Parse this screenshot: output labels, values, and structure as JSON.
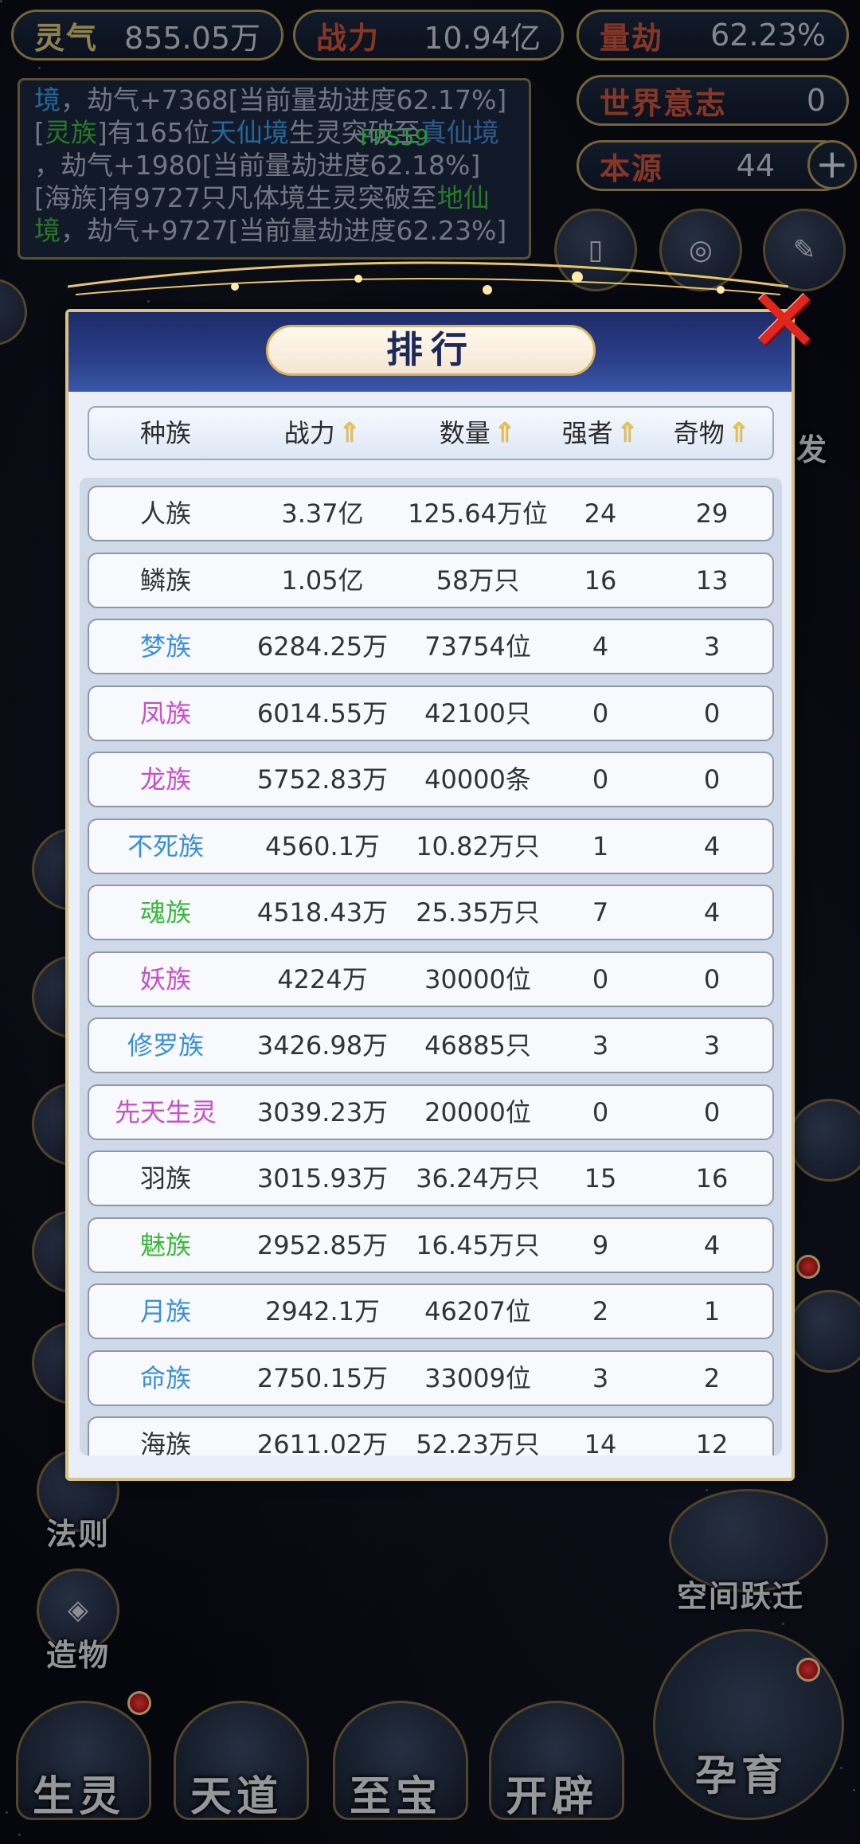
{
  "resources": {
    "lingqi": {
      "label": "灵气",
      "value": "855.05万"
    },
    "zhanli": {
      "label": "战力",
      "value": "10.94亿"
    },
    "liangjie": {
      "label": "量劫",
      "value": "62.23%"
    },
    "world_will": {
      "label": "世界意志",
      "value": "0"
    },
    "benyuan": {
      "label": "本源",
      "value": "44"
    }
  },
  "fps": "FPS59",
  "log": [
    [
      "境",
      "，劫气+7368[当前量劫进度62.17%]"
    ],
    [
      "[",
      "灵族",
      "]有165位",
      "天仙境",
      "生灵突破至",
      "真仙境"
    ],
    [
      "，劫气+1980[当前量劫进度62.18%]"
    ],
    [
      "[海族]有9727只凡体境生灵突破至",
      "地仙"
    ],
    [
      "境",
      "，劫气+9727[当前量劫进度62.23%]"
    ]
  ],
  "side_labels": {
    "fa_ze": "法则",
    "zao_wu": "造物",
    "kong_jian": "空间跃迁",
    "fa": "发"
  },
  "nav": [
    "生灵",
    "天道",
    "至宝",
    "开辟",
    "孕育"
  ],
  "modal": {
    "title": "排行",
    "columns": [
      "种族",
      "战力",
      "数量",
      "强者",
      "奇物"
    ],
    "rows": [
      {
        "race": "人族",
        "power": "3.37亿",
        "count": "125.64万位",
        "strong": "24",
        "items": "29",
        "color": "#333333"
      },
      {
        "race": "鳞族",
        "power": "1.05亿",
        "count": "58万只",
        "strong": "16",
        "items": "13",
        "color": "#333333"
      },
      {
        "race": "梦族",
        "power": "6284.25万",
        "count": "73754位",
        "strong": "4",
        "items": "3",
        "color": "#3a8fd9"
      },
      {
        "race": "凤族",
        "power": "6014.55万",
        "count": "42100只",
        "strong": "0",
        "items": "0",
        "color": "#c84fc8"
      },
      {
        "race": "龙族",
        "power": "5752.83万",
        "count": "40000条",
        "strong": "0",
        "items": "0",
        "color": "#c84fc8"
      },
      {
        "race": "不死族",
        "power": "4560.1万",
        "count": "10.82万只",
        "strong": "1",
        "items": "4",
        "color": "#3a8fd9"
      },
      {
        "race": "魂族",
        "power": "4518.43万",
        "count": "25.35万只",
        "strong": "7",
        "items": "4",
        "color": "#39b739"
      },
      {
        "race": "妖族",
        "power": "4224万",
        "count": "30000位",
        "strong": "0",
        "items": "0",
        "color": "#c84fc8"
      },
      {
        "race": "修罗族",
        "power": "3426.98万",
        "count": "46885只",
        "strong": "3",
        "items": "3",
        "color": "#3a8fd9"
      },
      {
        "race": "先天生灵",
        "power": "3039.23万",
        "count": "20000位",
        "strong": "0",
        "items": "0",
        "color": "#c84fc8"
      },
      {
        "race": "羽族",
        "power": "3015.93万",
        "count": "36.24万只",
        "strong": "15",
        "items": "16",
        "color": "#333333"
      },
      {
        "race": "魅族",
        "power": "2952.85万",
        "count": "16.45万只",
        "strong": "9",
        "items": "4",
        "color": "#39b739"
      },
      {
        "race": "月族",
        "power": "2942.1万",
        "count": "46207位",
        "strong": "2",
        "items": "1",
        "color": "#3a8fd9"
      },
      {
        "race": "命族",
        "power": "2750.15万",
        "count": "33009位",
        "strong": "3",
        "items": "2",
        "color": "#3a8fd9"
      },
      {
        "race": "海族",
        "power": "2611.02万",
        "count": "52.23万只",
        "strong": "14",
        "items": "12",
        "color": "#333333"
      }
    ]
  }
}
